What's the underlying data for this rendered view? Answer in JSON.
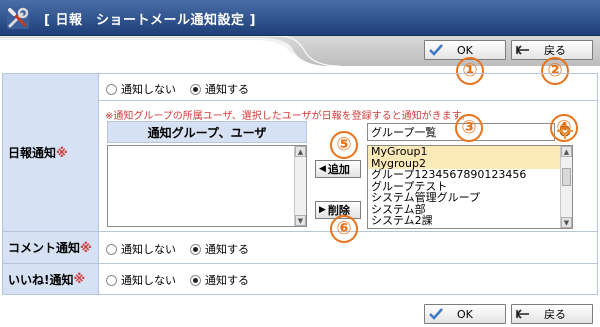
{
  "header": {
    "title": "[ 日報　ショートメール通知設定 ]"
  },
  "toolbar": {
    "ok_label": "OK",
    "back_label": "戻る"
  },
  "callouts": [
    "①",
    "②",
    "③",
    "④",
    "⑤",
    "⑥"
  ],
  "rows": {
    "nippou": {
      "label": "日報通知",
      "required_mark": "※",
      "options": [
        "通知しない",
        "通知する"
      ],
      "selected": "通知する",
      "note": "※通知グループの所属ユーザ、選択したユーザが日報を登録すると通知がきます。",
      "list_header": "通知グループ、ユーザ",
      "add_label": "追加",
      "remove_label": "削除",
      "group_select": "グループ一覧",
      "group_items": [
        "MyGroup1",
        "Mygroup2",
        "グループ1234567890123456",
        "グループテスト",
        "システム管理グループ",
        "システム部",
        "システム2課"
      ],
      "selected_items": [
        "MyGroup1",
        "Mygroup2"
      ]
    },
    "comment": {
      "label": "コメント通知",
      "required_mark": "※",
      "options": [
        "通知しない",
        "通知する"
      ],
      "selected": "通知する"
    },
    "iine": {
      "label": "いいね!通知",
      "required_mark": "※",
      "options": [
        "通知しない",
        "通知する"
      ],
      "selected": "通知する"
    }
  },
  "footer": {
    "ok_label": "OK",
    "back_label": "戻る"
  },
  "colors": {
    "header": "#2b4d8a",
    "label_bg": "#d6e2f4",
    "required": "#d43a3a",
    "callout": "#e8731b",
    "selected_row": "#fbe9b8"
  }
}
